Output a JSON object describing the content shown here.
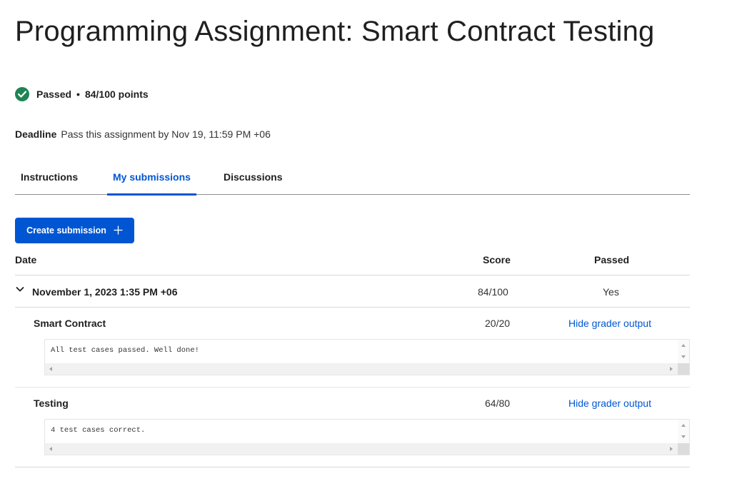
{
  "page": {
    "title": "Programming Assignment: Smart Contract Testing"
  },
  "status": {
    "icon": "check-circle-icon",
    "color": "#1f8354",
    "passed_label": "Passed",
    "separator": "•",
    "points": "84/100 points"
  },
  "deadline": {
    "label": "Deadline",
    "text": "Pass this assignment by Nov 19, 11:59 PM +06"
  },
  "tabs": [
    {
      "label": "Instructions",
      "active": false
    },
    {
      "label": "My submissions",
      "active": true
    },
    {
      "label": "Discussions",
      "active": false
    }
  ],
  "actions": {
    "create_submission_label": "Create submission",
    "create_submission_icon": "plus-icon",
    "accent": "#0056d2"
  },
  "table": {
    "columns": {
      "date": "Date",
      "score": "Score",
      "passed": "Passed"
    },
    "submission": {
      "expand_icon": "chevron-down-icon",
      "date": "November 1, 2023 1:35 PM +06",
      "score": "84/100",
      "passed": "Yes"
    },
    "parts": [
      {
        "name": "Smart Contract",
        "score": "20/20",
        "toggle_label": "Hide grader output",
        "output": "All test cases passed. Well done!"
      },
      {
        "name": "Testing",
        "score": "64/80",
        "toggle_label": "Hide grader output",
        "output": "4 test cases correct."
      }
    ]
  }
}
